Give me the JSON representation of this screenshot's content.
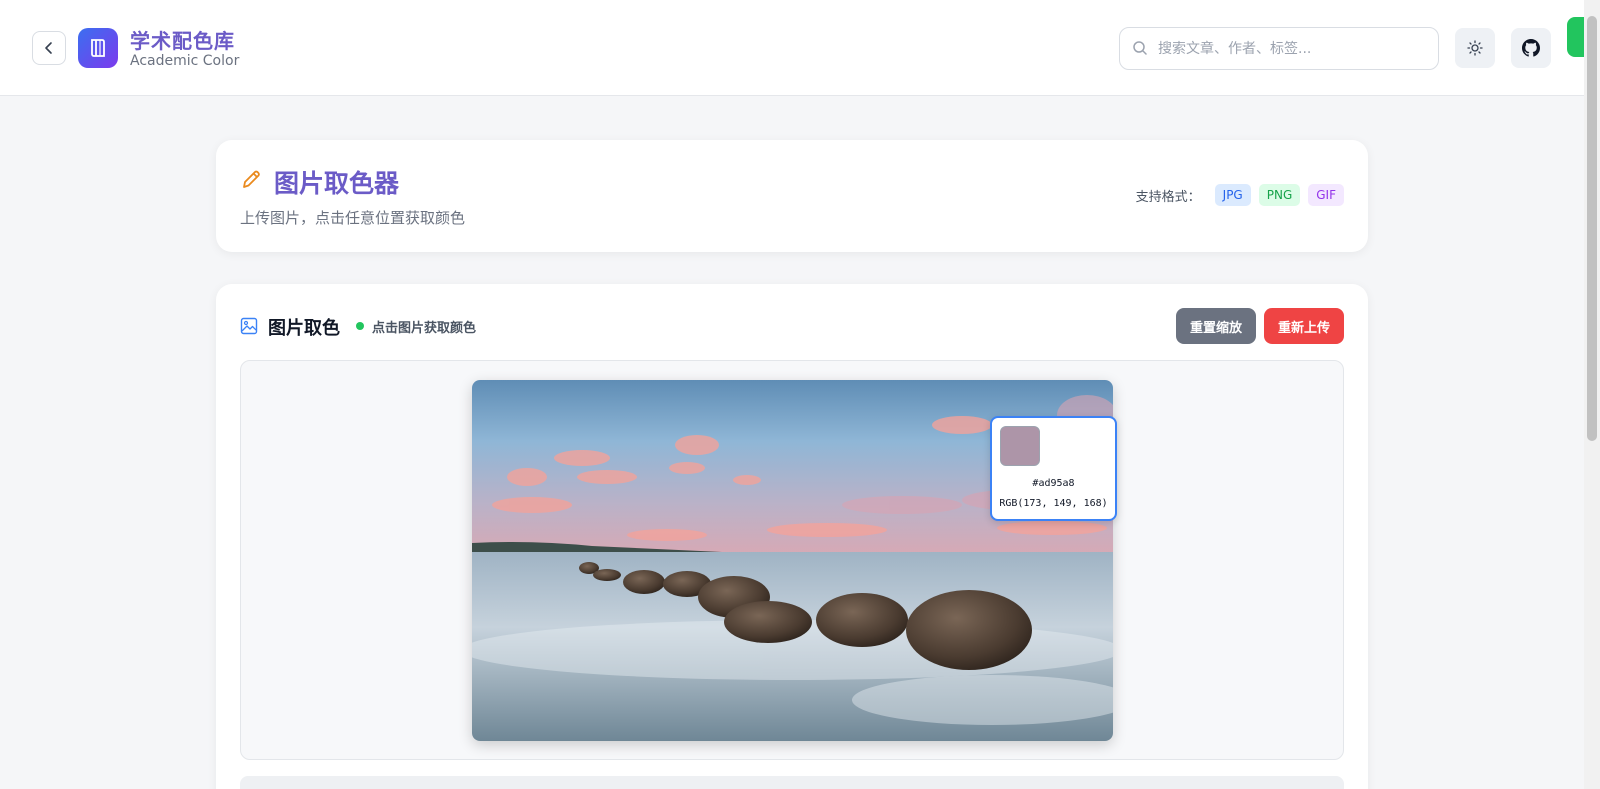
{
  "header": {
    "brand_title": "学术配色库",
    "brand_subtitle": "Academic Color",
    "search_placeholder": "搜索文章、作者、标签..."
  },
  "page": {
    "title": "图片取色器",
    "subtitle": "上传图片，点击任意位置获取颜色",
    "formats_label": "支持格式：",
    "formats": [
      "JPG",
      "PNG",
      "GIF"
    ]
  },
  "picker_panel": {
    "title": "图片取色",
    "hint": "点击图片获取颜色",
    "reset_zoom_label": "重置缩放",
    "reupload_label": "重新上传"
  },
  "color_picker": {
    "hex": "#ad95a8",
    "rgb": "RGB(173, 149, 168)",
    "swatch_color": "#ad95a8"
  },
  "colors": {
    "accent": "#6b5bc7",
    "reset_button": "#6b7280",
    "reupload_button": "#ef4444",
    "status_dot": "#22c55e"
  }
}
